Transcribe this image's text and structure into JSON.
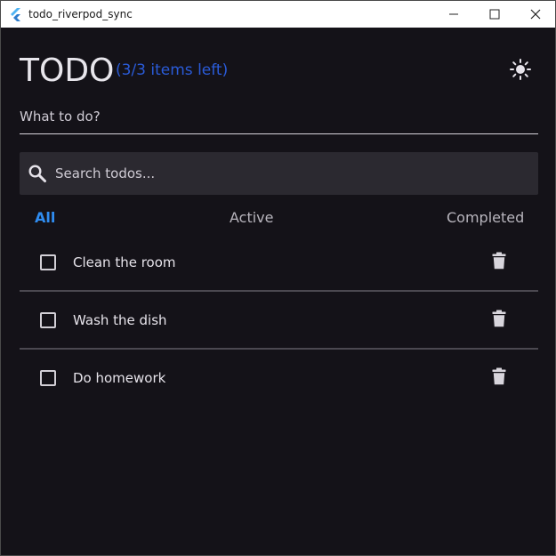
{
  "window": {
    "title": "todo_riverpod_sync",
    "controls": [
      "minimize",
      "maximize",
      "close"
    ]
  },
  "header": {
    "title": "TODO",
    "items_left": "(3/3 items left)",
    "theme_icon": "sun-icon"
  },
  "new_todo": {
    "placeholder": "What to do?"
  },
  "search": {
    "placeholder": "Search todos...",
    "icon": "search-icon"
  },
  "filters": {
    "all": "All",
    "active": "Active",
    "completed": "Completed",
    "selected": "All"
  },
  "todos": [
    {
      "label": "Clean the room",
      "completed": false
    },
    {
      "label": "Wash the dish",
      "completed": false
    },
    {
      "label": "Do homework",
      "completed": false
    }
  ],
  "colors": {
    "background": "#141218",
    "accent": "#2f8cf0",
    "items_left": "#2a5bd8",
    "search_bg": "#2b2930"
  }
}
